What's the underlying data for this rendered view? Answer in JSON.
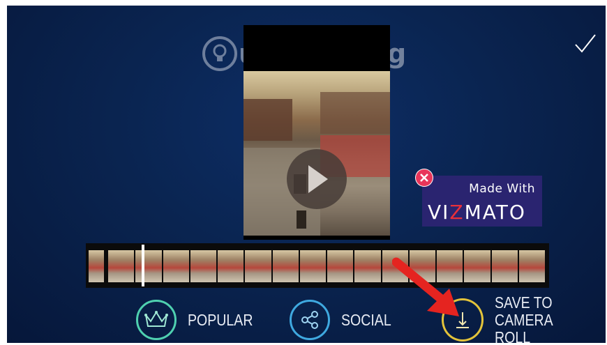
{
  "watermark": {
    "text": "uantrimang"
  },
  "topbar": {
    "confirm_icon": "checkmark-icon"
  },
  "video": {
    "play_icon": "play-icon"
  },
  "badge": {
    "line1": "Made With",
    "brand_pre": "VI",
    "brand_z": "Z",
    "brand_post": "MATO",
    "remove_icon": "close-icon"
  },
  "timeline": {
    "frames": 17
  },
  "actions": [
    {
      "label": "POPULAR",
      "icon": "crown-icon",
      "color": "#4fd0b0"
    },
    {
      "label": "SOCIAL",
      "icon": "share-icon",
      "color": "#3fa9e0"
    },
    {
      "label_line1": "SAVE TO",
      "label_line2": "CAMERA ROLL",
      "icon": "download-icon",
      "color": "#e3c33a"
    }
  ],
  "colors": {
    "background": "#0a2450",
    "arrow": "#e52420"
  }
}
